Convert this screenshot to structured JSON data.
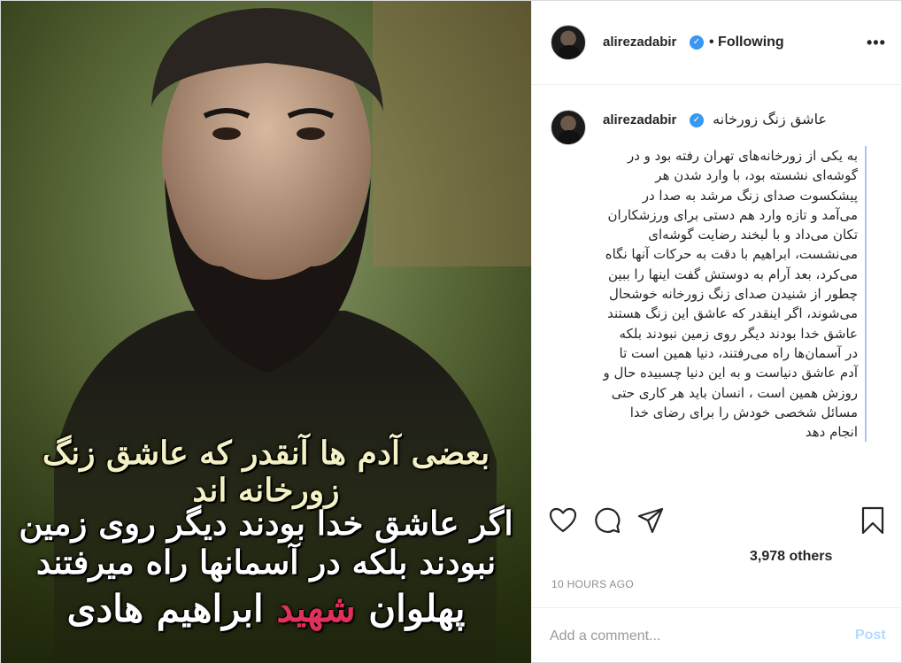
{
  "post_image": {
    "caption_line1": "بعضی آدم ها آنقدر که عاشق زنگ زورخانه اند",
    "caption_line2": "اگر عاشق خدا بودند دیگر روی زمین نبودند بلکه در آسمانها راه میرفتند",
    "caption_line3_prefix": "پهلوان",
    "caption_line3_highlight": "شهید",
    "caption_line3_suffix": "ابراهیم هادی"
  },
  "header": {
    "username": "alirezadabir",
    "follow_status": "• Following"
  },
  "caption": {
    "username": "alirezadabir",
    "title": "عاشق زنگ زورخانه",
    "body": "به یکی از زورخانه‌های تهران رفته بود و در گوشه‌ای نشسته بود، با وارد شدن هر پیشکسوت صدای زنگ مرشد به صدا در می‌آمد و تازه وارد هم دستی برای ورزشکاران تکان می‌داد و با لبخند رضایت گوشه‌ای می‌نشست، ابراهیم با دقت به حرکات آنها نگاه می‌کرد، بعد آرام به دوستش گفت اینها را ببین چطور از شنیدن صدای زنگ زورخانه خوشحال می‌شوند، اگر اینقدر که عاشق این زنگ هستند عاشق خدا بودند دیگر روی زمین نبودند بلکه در آسمان‌ها راه می‌رفتند، دنیا همین است تا آدم عاشق دنیاست و به این دنیا چسبیده حال و روزش همین است ، انسان باید هر کاری حتی مسائل شخصی خودش را برای رضای خدا انجام دهد"
  },
  "likes": "3,978 others",
  "timestamp": "10 HOURS AGO",
  "comment_box": {
    "placeholder": "Add a comment...",
    "post_label": "Post"
  },
  "icons": {
    "like": "heart-icon",
    "comment": "comment-icon",
    "share": "share-icon",
    "save": "bookmark-icon",
    "more": "more-options-icon",
    "verified": "verified-badge-icon"
  },
  "colors": {
    "verified": "#3897f0",
    "post_button": "#b3dbff",
    "caption_highlight": "#e0315a"
  }
}
